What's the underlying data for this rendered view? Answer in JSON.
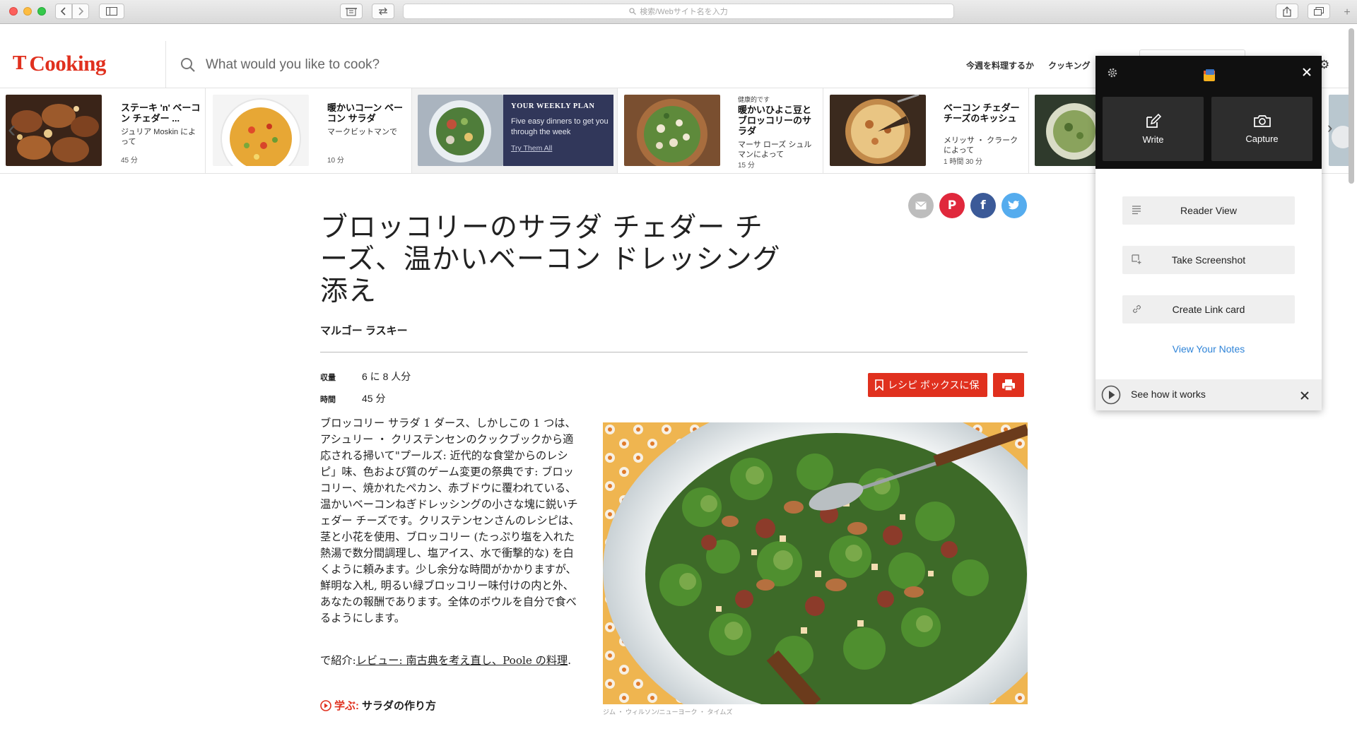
{
  "browser": {
    "address_placeholder": "検索/Webサイト名を入力",
    "new_tab": "+"
  },
  "header": {
    "logo_mark": "T",
    "logo_word": "Cooking",
    "search_placeholder": "What would you like to cook?",
    "nav": [
      "今週を料理するか",
      "クッキング"
    ]
  },
  "carousel": [
    {
      "title": "ステーキ 'n' ベーコン チェダー ...",
      "author": "ジュリア Moskin によって",
      "time": "45 分"
    },
    {
      "title": "暖かいコーン ベーコン サラダ",
      "author": "マークビットマンで",
      "time": "10 分"
    },
    {
      "promo_kicker": "YOUR WEEKLY PLAN",
      "promo_text": "Five easy dinners to get you through the week",
      "promo_link": "Try Them All"
    },
    {
      "kicker": "健康的です",
      "title": "暖かいひよこ豆とブロッコリーのサラダ",
      "author": "マーサ ローズ シュルマンによって",
      "time": "15 分"
    },
    {
      "title": "ベーコン チェダー チーズのキッシュ",
      "author": "メリッサ ・ クラークによって",
      "time": "1 時間 30 分"
    }
  ],
  "recipe": {
    "title": "ブロッコリーのサラダ チェダー チーズ、温かいベーコン ドレッシング添え",
    "author": "マルゴー ラスキー",
    "yield_label": "収量",
    "yield_value": "6 に 8 人分",
    "time_label": "時間",
    "time_value": "45 分",
    "save_label": "レシピ ボックスに保",
    "description": "ブロッコリー サラダ 1 ダース、しかしこの 1 つは、アシュリー ・ クリステンセンのクックブックから適応される掃いて\"プールズ: 近代的な食堂からのレシピ」味、色および質のゲーム変更の祭典です: ブロッコリー、焼かれたペカン、赤ブドウに覆われている、温かいベーコンねぎドレッシングの小さな塊に鋭いチェダー チーズです。クリステンセンさんのレシピは、茎と小花を使用、ブロッコリー (たっぷり塩を入れた熱湯で数分間調理し、塩アイス、水で衝撃的な) を白くように頼みます。少し余分な時間がかかりますが、鮮明な入札, 明るい緑ブロッコリー味付けの内と外、あなたの報酬であります。全体のボウルを自分で食べるようにします。",
    "featured_prefix": "で紹介:",
    "featured_link": "レビュー: 南古典を考え直し、Poole の料理",
    "featured_suffix": ".",
    "learn_label": "学ぶ:",
    "learn_text": "サラダの作り方",
    "photo_credit": "ジム ・ ウィルソン/ニューヨーク ・ タイムズ"
  },
  "popup": {
    "write": "Write",
    "capture": "Capture",
    "options": [
      "Reader View",
      "Take Screenshot",
      "Create Link card"
    ],
    "view_notes": "View Your Notes",
    "see_how": "See how it works"
  },
  "colors": {
    "brand_red": "#e0301e",
    "pinterest": "#e0283c",
    "facebook": "#3b5a98",
    "twitter": "#55acee",
    "mail": "#bdbdbd",
    "popup_dark": "#101010",
    "link_blue": "#2f84d8"
  }
}
